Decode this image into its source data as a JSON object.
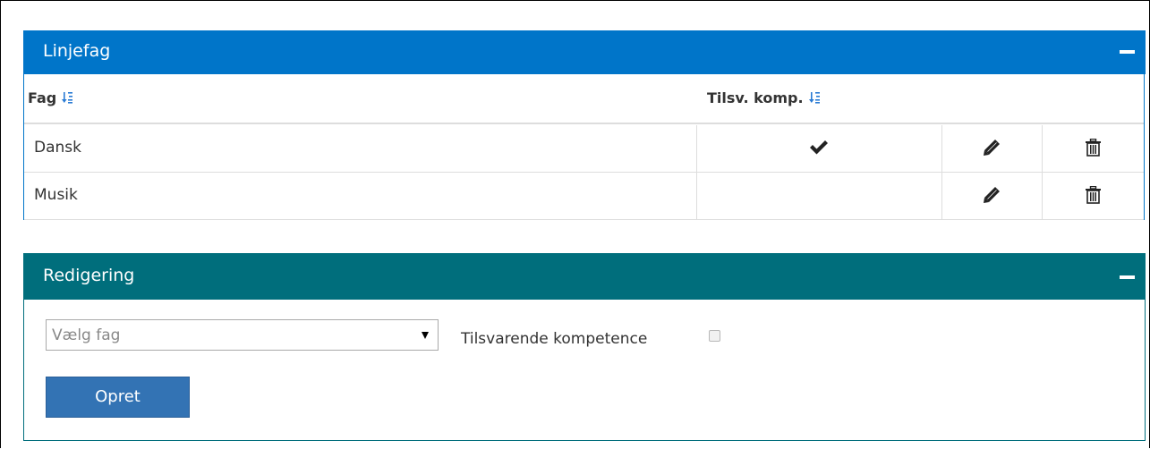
{
  "panels": {
    "linjefag": {
      "title": "Linjefag",
      "collapse_label": "collapse",
      "columns": {
        "fag": "Fag",
        "tilsv": "Tilsv. komp."
      },
      "rows": [
        {
          "fag": "Dansk",
          "tilsv_kompetence": true,
          "edit_icon": "pencil-icon",
          "delete_icon": "trash-icon"
        },
        {
          "fag": "Musik",
          "tilsv_kompetence": false,
          "edit_icon": "pencil-icon",
          "delete_icon": "trash-icon"
        }
      ]
    },
    "redigering": {
      "title": "Redigering",
      "select": {
        "placeholder": "Vælg fag",
        "value": "Vælg fag"
      },
      "checkbox_label": "Tilsvarende kompetence",
      "checkbox_checked": false,
      "submit_label": "Opret"
    }
  },
  "icons": {
    "sort": "sort-alpha-icon",
    "check": "checkmark-icon",
    "edit": "pencil-icon",
    "delete": "trash-icon",
    "collapse": "minus-icon"
  },
  "colors": {
    "linjefag_header": "#0075c9",
    "redigering_header": "#006e7c",
    "button": "#3373b4",
    "sort_icon": "#2a7bd4"
  }
}
